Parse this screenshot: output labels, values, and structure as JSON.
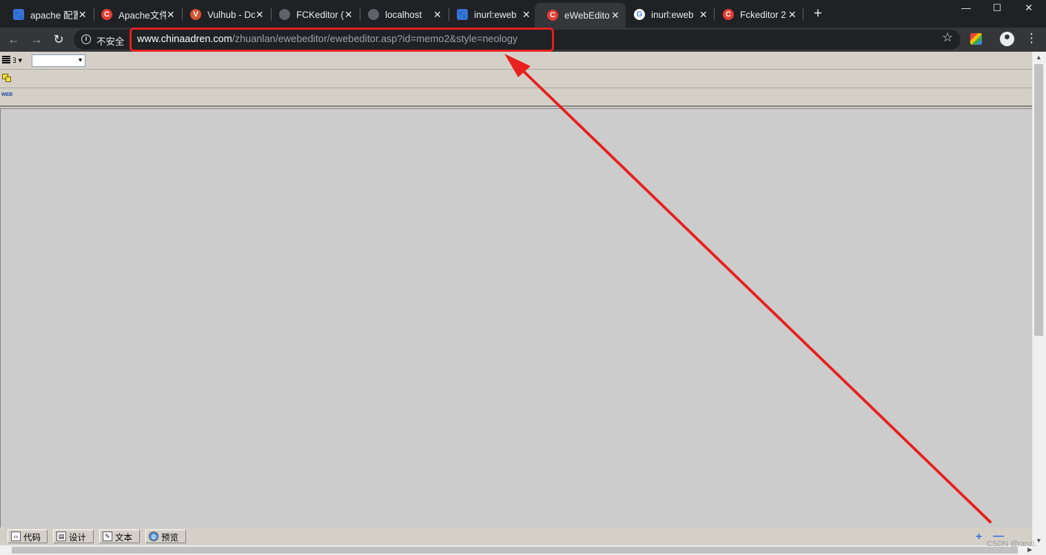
{
  "tabs": [
    {
      "title": "apache 配置",
      "favicon": "paw-icon"
    },
    {
      "title": "Apache文件",
      "favicon": "csdn-icon"
    },
    {
      "title": "Vulhub - Do",
      "favicon": "vulhub-icon"
    },
    {
      "title": "FCKeditor (",
      "favicon": "globe-icon"
    },
    {
      "title": "localhost",
      "favicon": "globe-icon"
    },
    {
      "title": "inurl:eweb",
      "favicon": "paw-icon"
    },
    {
      "title": "eWebEdito",
      "favicon": "csdn-icon",
      "active": true
    },
    {
      "title": "inurl:eweb",
      "favicon": "google-icon"
    },
    {
      "title": "Fckeditor 2",
      "favicon": "csdn-icon"
    }
  ],
  "toolbar": {
    "security_label": "不安全",
    "url_host": "www.chinaadren.com",
    "url_path": "/zhuanlan/ewebeditor/ewebeditor.asp?id=memo2&style=neology"
  },
  "editor": {
    "paragraph_glyph": "ﾖ ▾",
    "font_select_value": "▾",
    "web_icon_text": "WEB",
    "mode_buttons": [
      "代码",
      "设计",
      "文本",
      "预览"
    ],
    "zoom_in": "+",
    "zoom_out": "—"
  },
  "watermark": "CSDN @ranzi.",
  "colors": {
    "annotation": "#e8201e",
    "chrome_dark": "#202124",
    "editor_gray": "#d4d0c8"
  }
}
